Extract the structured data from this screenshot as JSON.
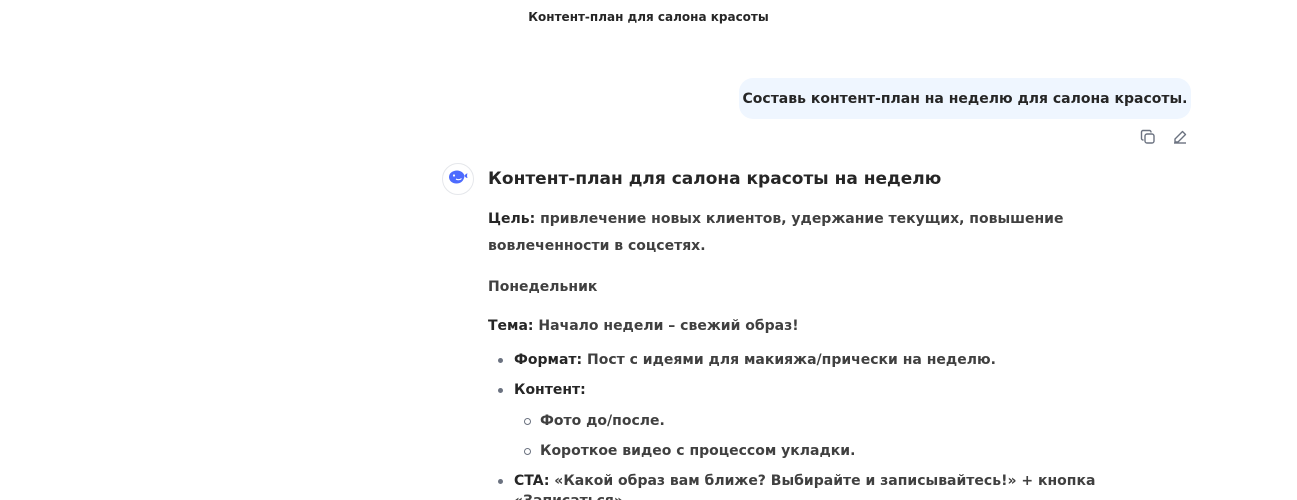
{
  "header": {
    "title": "Контент-план для салона красоты"
  },
  "user_message": {
    "text": "Составь контент-план на неделю для салона красоты."
  },
  "actions": {
    "copy_icon": "copy-icon",
    "edit_icon": "edit-icon"
  },
  "assistant": {
    "avatar_icon": "whale-icon",
    "heading": "Контент-план для салона красоты на неделю",
    "goal_label": "Цель:",
    "goal_text": " привлечение новых клиентов, удержание текущих, повышение вовлеченности в соцсетях.",
    "day": "Понедельник",
    "theme_label": "Тема:",
    "theme_text": " Начало недели – свежий образ!",
    "format_label": "Формат:",
    "format_text": " Пост с идеями для макияжа/прически на неделю.",
    "content_label": "Контент:",
    "content_items": [
      "Фото до/после.",
      "Короткое видео с процессом укладки."
    ],
    "cta_label": "CTA:",
    "cta_text": " «Какой образ вам ближе? Выбирайте и записывайтесь!» + кнопка «Записаться»."
  },
  "colors": {
    "user_bubble": "#eff6ff",
    "accent": "#4d6bfe",
    "text": "#404040"
  }
}
